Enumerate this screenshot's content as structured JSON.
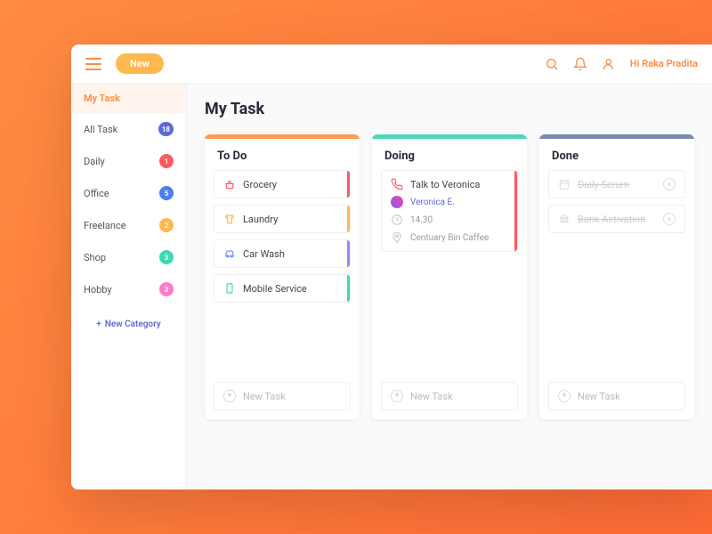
{
  "topbar": {
    "new_label": "New",
    "greeting": "Hi Raka Pradita"
  },
  "sidebar": {
    "items": [
      {
        "label": "My Task",
        "badge": null,
        "active": true
      },
      {
        "label": "All Task",
        "badge": "18",
        "color": "#5b6bd8"
      },
      {
        "label": "Daily",
        "badge": "1",
        "color": "#ff5a5f"
      },
      {
        "label": "Office",
        "badge": "5",
        "color": "#4a7ff5"
      },
      {
        "label": "Freelance",
        "badge": "2",
        "color": "#ffb84d"
      },
      {
        "label": "Shop",
        "badge": "3",
        "color": "#3dd9b5"
      },
      {
        "label": "Hobby",
        "badge": "3",
        "color": "#ff7bc8"
      }
    ],
    "new_category_label": "New Category"
  },
  "page_title": "My Task",
  "columns": {
    "todo": {
      "title": "To Do",
      "stripe": "#ff9a52",
      "new_task_label": "New Task",
      "tasks": [
        {
          "label": "Grocery",
          "stripe": "#ff5a5f",
          "icon": "basket",
          "icon_color": "#ff5a5f"
        },
        {
          "label": "Laundry",
          "stripe": "#ffb84d",
          "icon": "shirt",
          "icon_color": "#ffb84d"
        },
        {
          "label": "Car Wash",
          "stripe": "#8b8bff",
          "icon": "car",
          "icon_color": "#6b8bff"
        },
        {
          "label": "Mobile Service",
          "stripe": "#3dd9b5",
          "icon": "phone",
          "icon_color": "#3dd9b5"
        }
      ]
    },
    "doing": {
      "title": "Doing",
      "stripe": "#4ed8b8",
      "new_task_label": "New Task",
      "task": {
        "title": "Talk to Veronica",
        "stripe": "#ff5a5f",
        "person": "Veronica E.",
        "time": "14.30",
        "location": "Centuary Bin Caffee"
      }
    },
    "done": {
      "title": "Done",
      "stripe": "#7b8ab0",
      "new_task_label": "New Task",
      "tasks": [
        {
          "label": "Daily Scrum"
        },
        {
          "label": "Bank Activation"
        }
      ]
    }
  }
}
